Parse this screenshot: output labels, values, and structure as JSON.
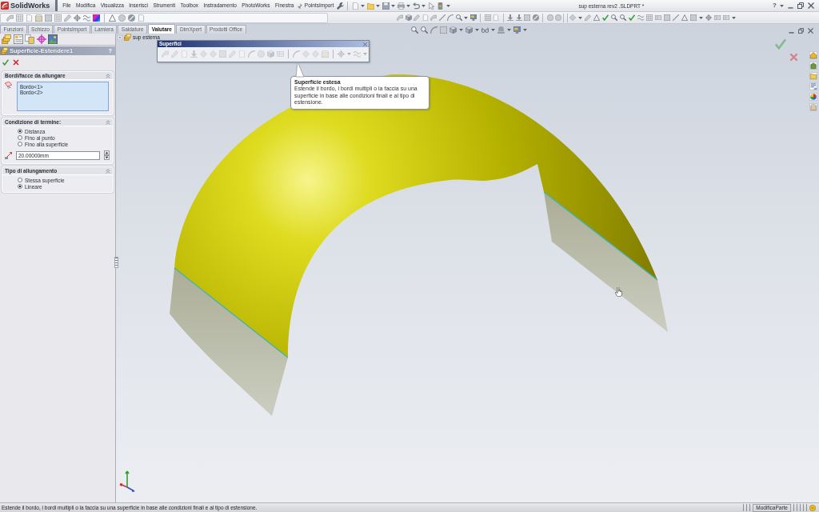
{
  "menu_bar": {
    "logo": "SolidWorks",
    "items": [
      "File",
      "Modifica",
      "Visualizza",
      "Inserisci",
      "Strumenti",
      "Toolbox",
      "Instradamento",
      "PhotoWorks",
      "Finestra",
      "PointsImport"
    ],
    "title": "sup esterna rev2 .SLDPRT *",
    "help": "?"
  },
  "command_tabs": [
    {
      "label": "Funzioni",
      "selected": false
    },
    {
      "label": "Schizzo",
      "selected": false
    },
    {
      "label": "PointsImport",
      "selected": false
    },
    {
      "label": "Lamiera",
      "selected": false
    },
    {
      "label": "Saldature",
      "selected": false
    },
    {
      "label": "Valutare",
      "selected": true
    },
    {
      "label": "DimXpert",
      "selected": false
    },
    {
      "label": "Prodotti Office",
      "selected": false
    }
  ],
  "property_manager": {
    "title": "Superficie-Estendere1",
    "help": "?",
    "sections": [
      {
        "kind": "selection",
        "title": "Bordi/facce da allungare",
        "items": [
          "Bordo<1>",
          "Bordo<2>"
        ]
      },
      {
        "kind": "end_condition",
        "title": "Condizione di termine:",
        "options": [
          {
            "label": "Distanza",
            "selected": true
          },
          {
            "label": "Fino al punto",
            "selected": false
          },
          {
            "label": "Fino alla superficie",
            "selected": false
          }
        ],
        "distance": "20.00000mm"
      },
      {
        "kind": "options",
        "title": "Tipo di allungamento",
        "options": [
          {
            "label": "Stessa superficie",
            "selected": false
          },
          {
            "label": "Lineare",
            "selected": true
          }
        ]
      }
    ]
  },
  "feature_tree": {
    "root": "sup esterna"
  },
  "floating_toolbar": {
    "title": "Superfici"
  },
  "tooltip": {
    "title": "Superficie estesa",
    "text": "Estende il bordo, i bordi multipli o la faccia su una superficie in base alle condizioni finali e al tipo di estensione."
  },
  "status_bar": {
    "message": "Estende il bordo, i bordi multipli o la faccia su una superficie in base alle condizioni finali e al tipo di estensione.",
    "mode": "ModificaParte"
  }
}
